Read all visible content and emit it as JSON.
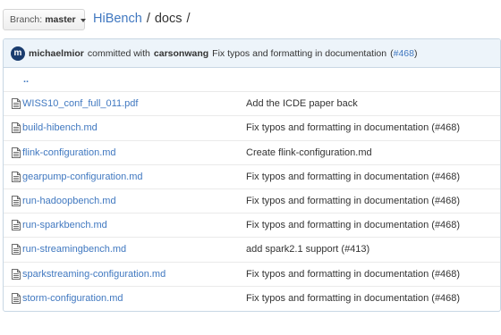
{
  "branch": {
    "label": "Branch:",
    "value": "master"
  },
  "breadcrumb": {
    "repo": "HiBench",
    "sep1": "/",
    "folder": "docs",
    "sep2": "/"
  },
  "commit": {
    "avatar_initial": "m",
    "author": "michaelmior",
    "mid_text": "committed with",
    "committer": "carsonwang",
    "message": "Fix typos and formatting in documentation",
    "pr_open": "(",
    "pr": "#468",
    "pr_close": ")"
  },
  "parent_link": "..",
  "files": [
    {
      "name": "WISS10_conf_full_011.pdf",
      "message": "Add the ICDE paper back"
    },
    {
      "name": "build-hibench.md",
      "message": "Fix typos and formatting in documentation (#468)"
    },
    {
      "name": "flink-configuration.md",
      "message": "Create flink-configuration.md"
    },
    {
      "name": "gearpump-configuration.md",
      "message": "Fix typos and formatting in documentation (#468)"
    },
    {
      "name": "run-hadoopbench.md",
      "message": "Fix typos and formatting in documentation (#468)"
    },
    {
      "name": "run-sparkbench.md",
      "message": "Fix typos and formatting in documentation (#468)"
    },
    {
      "name": "run-streamingbench.md",
      "message": "add spark2.1 support (#413)"
    },
    {
      "name": "sparkstreaming-configuration.md",
      "message": "Fix typos and formatting in documentation (#468)"
    },
    {
      "name": "storm-configuration.md",
      "message": "Fix typos and formatting in documentation (#468)"
    }
  ]
}
